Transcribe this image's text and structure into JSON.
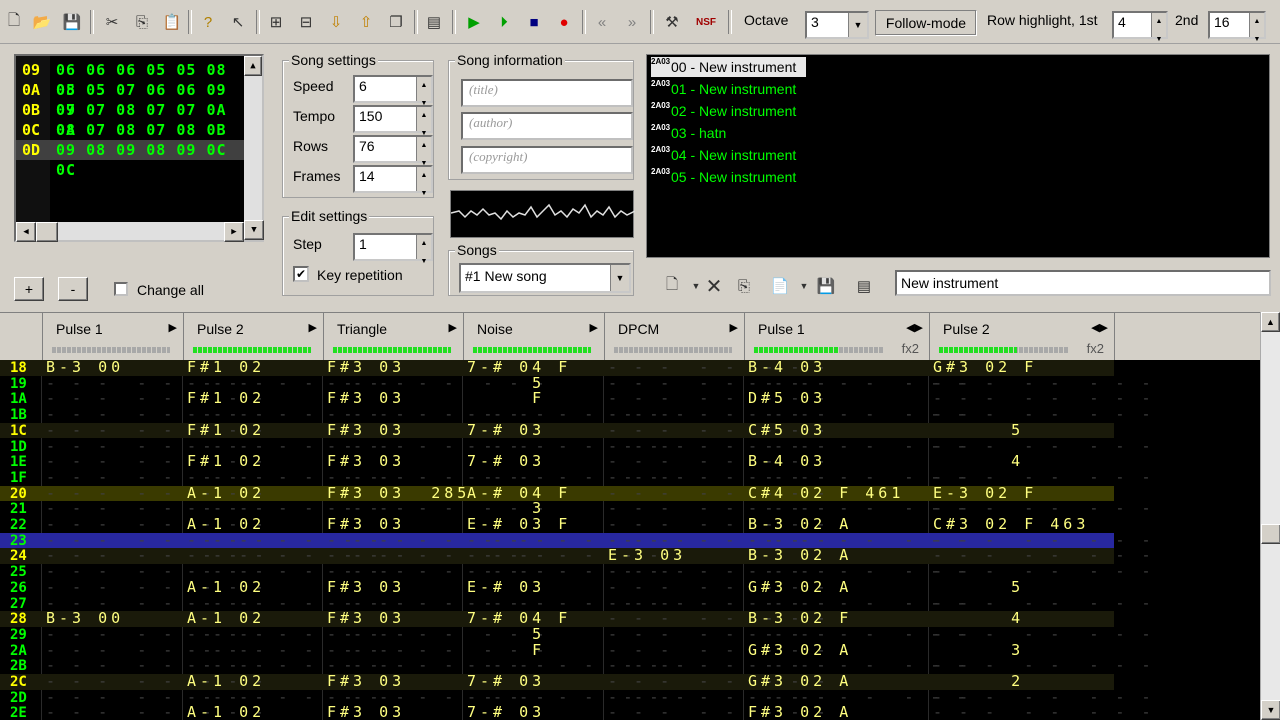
{
  "toolbar": {
    "octave_label": "Octave",
    "octave_value": "3",
    "follow_mode": "Follow-mode",
    "row_highlight_label": "Row highlight, 1st",
    "row_highlight_1st": "4",
    "second_label": "2nd",
    "row_highlight_2nd": "16",
    "nsf_label": "NSF"
  },
  "frames": {
    "rows": [
      {
        "num": "09",
        "vals": "06 06 06 05 05 08 08"
      },
      {
        "num": "0A",
        "vals": "05 05 07 06 06 09 09"
      },
      {
        "num": "0B",
        "vals": "07 07 08 07 07 0A 0A"
      },
      {
        "num": "0C",
        "vals": "08 07 08 07 08 0B 0B"
      },
      {
        "num": "0D",
        "vals": "09 08 09 08 09 0C 0C"
      }
    ],
    "add_label": "+",
    "remove_label": "-",
    "change_all": "Change all"
  },
  "song_settings": {
    "title": "Song settings",
    "speed_label": "Speed",
    "speed": "6",
    "tempo_label": "Tempo",
    "tempo": "150",
    "rows_label": "Rows",
    "rows": "76",
    "frames_label": "Frames",
    "frames": "14"
  },
  "edit_settings": {
    "title": "Edit settings",
    "step_label": "Step",
    "step": "1",
    "key_repetition": "Key repetition"
  },
  "song_info": {
    "title": "Song information",
    "title_placeholder": "(title)",
    "author_placeholder": "(author)",
    "copyright_placeholder": "(copyright)"
  },
  "songs": {
    "title": "Songs",
    "selected": "#1 New song"
  },
  "instruments": {
    "items": [
      "00 - New instrument",
      "01 - New instrument",
      "02 - New instrument",
      "03 - hatn",
      "04 - New instrument",
      "05 - New instrument"
    ],
    "icon_text": "2A03",
    "name_field": "New instrument"
  },
  "channels": [
    {
      "name": "Pulse 1",
      "arrow": "▶",
      "fx": ""
    },
    {
      "name": "Pulse 2",
      "arrow": "▶",
      "fx": ""
    },
    {
      "name": "Triangle",
      "arrow": "▶",
      "fx": ""
    },
    {
      "name": "Noise",
      "arrow": "▶",
      "fx": ""
    },
    {
      "name": "DPCM",
      "arrow": "▶",
      "fx": ""
    },
    {
      "name": "Pulse 1",
      "arrow": "◀▶",
      "fx": "fx2"
    },
    {
      "name": "Pulse 2",
      "arrow": "◀▶",
      "fx": "fx2"
    }
  ],
  "pattern_rows": [
    {
      "n": "18",
      "c": [
        "B-3 00",
        "F#1 02",
        "F#3 03",
        "7-# 04 F",
        "",
        "B-4 03",
        "G#3 02 F"
      ]
    },
    {
      "n": "19",
      "c": [
        "",
        "",
        "",
        "     5",
        "",
        "",
        ""
      ]
    },
    {
      "n": "1A",
      "c": [
        "",
        "F#1 02",
        "F#3 03",
        "     F",
        "",
        "D#5 03",
        ""
      ]
    },
    {
      "n": "1B",
      "c": [
        "",
        "",
        "",
        "",
        "",
        "",
        ""
      ]
    },
    {
      "n": "1C",
      "c": [
        "",
        "F#1 02",
        "F#3 03",
        "7-# 03",
        "",
        "C#5 03",
        "      5"
      ]
    },
    {
      "n": "1D",
      "c": [
        "",
        "",
        "",
        "",
        "",
        "",
        ""
      ]
    },
    {
      "n": "1E",
      "c": [
        "",
        "F#1 02",
        "F#3 03",
        "7-# 03",
        "",
        "B-4 03",
        "      4"
      ]
    },
    {
      "n": "1F",
      "c": [
        "",
        "",
        "",
        "",
        "",
        "",
        ""
      ]
    },
    {
      "n": "20",
      "c": [
        "",
        "A-1 02",
        "F#3 03  285",
        "A-# 04 F",
        "",
        "C#4 02 F 461",
        "E-3 02 F"
      ]
    },
    {
      "n": "21",
      "c": [
        "",
        "",
        "",
        "     3",
        "",
        "",
        ""
      ]
    },
    {
      "n": "22",
      "c": [
        "",
        "A-1 02",
        "F#3 03",
        "E-# 03 F",
        "",
        "B-3 02 A",
        "C#3 02 F 463"
      ]
    },
    {
      "n": "23",
      "c": [
        "",
        "",
        "",
        "",
        "",
        "",
        ""
      ]
    },
    {
      "n": "24",
      "c": [
        "",
        "",
        "",
        "",
        "E-3 03",
        "B-3 02 A",
        ""
      ]
    },
    {
      "n": "25",
      "c": [
        "",
        "",
        "",
        "",
        "",
        "",
        ""
      ]
    },
    {
      "n": "26",
      "c": [
        "",
        "A-1 02",
        "F#3 03",
        "E-# 03",
        "",
        "G#3 02 A",
        "      5"
      ]
    },
    {
      "n": "27",
      "c": [
        "",
        "",
        "",
        "",
        "",
        "",
        ""
      ]
    },
    {
      "n": "28",
      "c": [
        "B-3 00",
        "A-1 02",
        "F#3 03",
        "7-# 04 F",
        "",
        "B-3 02 F",
        "      4"
      ]
    },
    {
      "n": "29",
      "c": [
        "",
        "",
        "",
        "     5",
        "",
        "",
        ""
      ]
    },
    {
      "n": "2A",
      "c": [
        "",
        "",
        "",
        "     F",
        "",
        "G#3 02 A",
        "      3"
      ]
    },
    {
      "n": "2B",
      "c": [
        "",
        "",
        "",
        "",
        "",
        "",
        ""
      ]
    },
    {
      "n": "2C",
      "c": [
        "",
        "A-1 02",
        "F#3 03",
        "7-# 03",
        "",
        "G#3 02 A",
        "      2"
      ]
    },
    {
      "n": "2D",
      "c": [
        "",
        "",
        "",
        "",
        "",
        "",
        ""
      ]
    },
    {
      "n": "2E",
      "c": [
        "",
        "A-1 02",
        "F#3 03",
        "7-# 03",
        "",
        "F#3 02 A",
        ""
      ]
    }
  ]
}
